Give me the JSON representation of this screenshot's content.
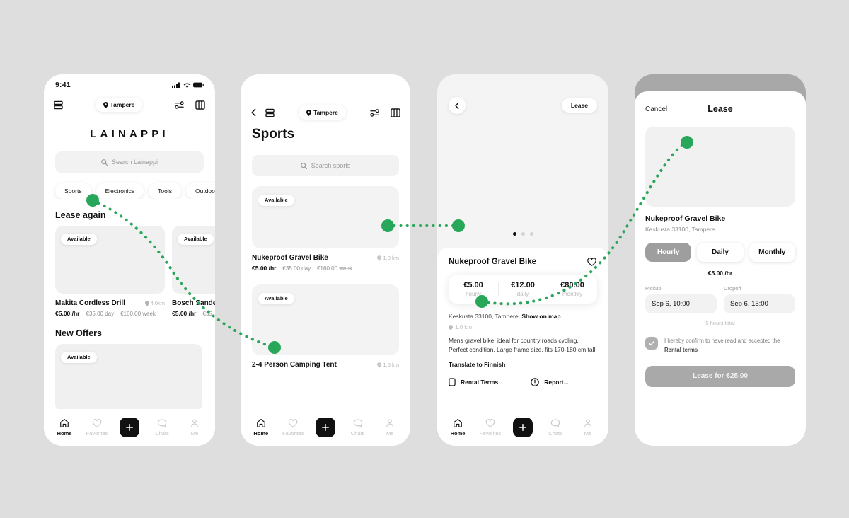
{
  "theme": {
    "accent_green": "#28a75a",
    "page_background": "#dedede",
    "dark": "#111111"
  },
  "screen1": {
    "name": "home",
    "status_bar": {
      "time": "9:41",
      "icons": [
        "cellular-icon",
        "wifi-icon",
        "battery-icon"
      ]
    },
    "header": {
      "menu_icon": "stacked-list-icon",
      "location": "Tampere",
      "filter_icon": "filters-icon",
      "map_icon": "map-icon"
    },
    "brand": "LAINAPPI",
    "search": {
      "placeholder": "Search Lainappi",
      "icon": "search-icon"
    },
    "categories": [
      "Sports",
      "Electronics",
      "Tools",
      "Outdoo"
    ],
    "sections": [
      {
        "title": "Lease again",
        "cards": [
          {
            "badge": "Available",
            "title": "Makita Cordless Drill",
            "distance": "4.0km",
            "price_main": "€5.00 /hr",
            "price_day": "€35.00 day",
            "price_week": "€160.00 week"
          },
          {
            "badge": "Available",
            "title": "Bosch Sande",
            "distance": "",
            "price_main": "€5.00 /hr",
            "price_day": "€35.",
            "price_week": ""
          }
        ]
      },
      {
        "title": "New Offers",
        "cards": [
          {
            "badge": "Available",
            "title": "",
            "distance": "",
            "price_main": "",
            "price_day": "",
            "price_week": ""
          }
        ]
      }
    ],
    "tabs": [
      {
        "label": "Home",
        "icon": "home-icon",
        "active": true
      },
      {
        "label": "Favorites",
        "icon": "heart-icon",
        "active": false
      },
      {
        "label": "",
        "icon": "plus-icon",
        "active": false
      },
      {
        "label": "Chats",
        "icon": "chat-bubble-icon",
        "active": false
      },
      {
        "label": "Me",
        "icon": "person-icon",
        "active": false
      }
    ]
  },
  "screen2": {
    "name": "sports-category",
    "header": {
      "back_icon": "chevron-left-icon",
      "menu_icon": "stacked-list-icon",
      "location": "Tampere",
      "filter_icon": "filters-icon",
      "map_icon": "map-icon"
    },
    "title": "Sports",
    "search": {
      "placeholder": "Search sports",
      "icon": "search-icon"
    },
    "items": [
      {
        "badge": "Available",
        "title": "Nukeproof Gravel Bike",
        "distance": "1.0 km",
        "price_main": "€5.00 /hr",
        "price_day": "€35.00 day",
        "price_week": "€160.00 week"
      },
      {
        "badge": "Available",
        "title": "2-4 Person Camping Tent",
        "distance": "1.6 km",
        "price_main": "",
        "price_day": "",
        "price_week": ""
      }
    ],
    "tabs": [
      {
        "label": "Home",
        "icon": "home-icon",
        "active": true
      },
      {
        "label": "Favorites",
        "icon": "heart-icon",
        "active": false
      },
      {
        "label": "",
        "icon": "plus-icon",
        "active": false
      },
      {
        "label": "Chats",
        "icon": "chat-bubble-icon",
        "active": false
      },
      {
        "label": "Me",
        "icon": "person-icon",
        "active": false
      }
    ]
  },
  "screen3": {
    "name": "item-detail",
    "back_icon": "chevron-left-icon",
    "lease_button": "Lease",
    "carousel_dots": 3,
    "carousel_active": 0,
    "title": "Nukeproof Gravel Bike",
    "favorite_icon": "heart-icon",
    "prices": [
      {
        "amount": "€5.00",
        "label": "hourly"
      },
      {
        "amount": "€12.00",
        "label": "daily"
      },
      {
        "amount": "€80.00",
        "label": "monthly"
      }
    ],
    "address": "Keskusta 33100, Tampere,",
    "show_on_map": "Show on map",
    "distance": "1.0 km",
    "description_line1": "Mens gravel bike, ideal for country roads cycling.",
    "description_line2": "Perfect condition. Large frame size, fits 170-180 cm tall",
    "translate": "Translate to Finnish",
    "actions": [
      {
        "label": "Rental Terms",
        "icon": "document-icon"
      },
      {
        "label": "Report...",
        "icon": "info-circle-icon"
      }
    ],
    "tabs": [
      {
        "label": "Home",
        "icon": "home-icon",
        "active": true
      },
      {
        "label": "Favorites",
        "icon": "heart-icon",
        "active": false
      },
      {
        "label": "",
        "icon": "plus-icon",
        "active": false
      },
      {
        "label": "Chats",
        "icon": "chat-bubble-icon",
        "active": false
      },
      {
        "label": "Me",
        "icon": "person-icon",
        "active": false
      }
    ]
  },
  "screen4": {
    "name": "lease-modal",
    "cancel": "Cancel",
    "title": "Lease",
    "item_title": "Nukeproof Gravel Bike",
    "item_address": "Keskusta 33100, Tampere",
    "segments": [
      {
        "label": "Hourly",
        "selected": true
      },
      {
        "label": "Daily",
        "selected": false
      },
      {
        "label": "Monthly",
        "selected": false
      }
    ],
    "rate": "€5.00 /hr",
    "pickup": {
      "label": "Pickup",
      "value": "Sep 6, 10:00"
    },
    "dropoff": {
      "label": "Dropoff",
      "value": "Sep 6, 15:00"
    },
    "duration_total": "5 hours total",
    "consent": {
      "checked": true,
      "text_before": "I hereby confirm to have read and accepted the ",
      "text_link": "Rental terms",
      "icon": "checkmark-icon"
    },
    "cta": "Lease for €25.00"
  }
}
